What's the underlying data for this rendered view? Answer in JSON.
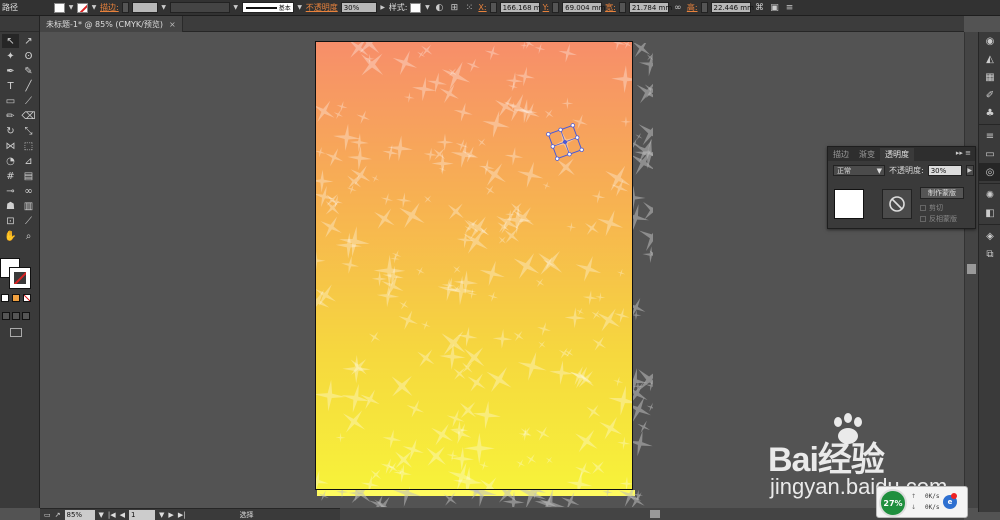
{
  "control_bar": {
    "object_type": "路径",
    "stroke_label": "描边:",
    "stroke_style": "基本",
    "opacity_label": "不透明度",
    "opacity_value": "30%",
    "style_label": "样式:",
    "x_label": "X:",
    "x_value": "166.168 m",
    "y_label": "Y:",
    "y_value": "69.004 mm",
    "w_label": "宽:",
    "w_value": "21.784 mm",
    "h_label": "高:",
    "h_value": "22.446 mm"
  },
  "document": {
    "tab_title": "未标题-1* @ 85% (CMYK/预览)",
    "close": "×"
  },
  "status_bar": {
    "zoom": "85%",
    "page": "1",
    "tool_status": "选择"
  },
  "transparency_panel": {
    "tabs": [
      "描边",
      "渐变",
      "透明度"
    ],
    "blend_mode": "正常",
    "opacity_label": "不透明度:",
    "opacity_value": "30%",
    "make_mask": "制作蒙版",
    "clip": "剪切",
    "invert_mask": "反相蒙版"
  },
  "watermark": {
    "brand": "Bai经验",
    "url": "jingyan.baidu.com"
  },
  "network_widget": {
    "percent": "27%",
    "up": "0K/s",
    "down": "0K/s"
  },
  "colors": {
    "gradient_top": "#f78e6a",
    "gradient_bottom": "#f7f23a",
    "ui_dark": "#3a3a3a",
    "canvas_bg": "#535353",
    "accent_orange": "#e8823c"
  }
}
